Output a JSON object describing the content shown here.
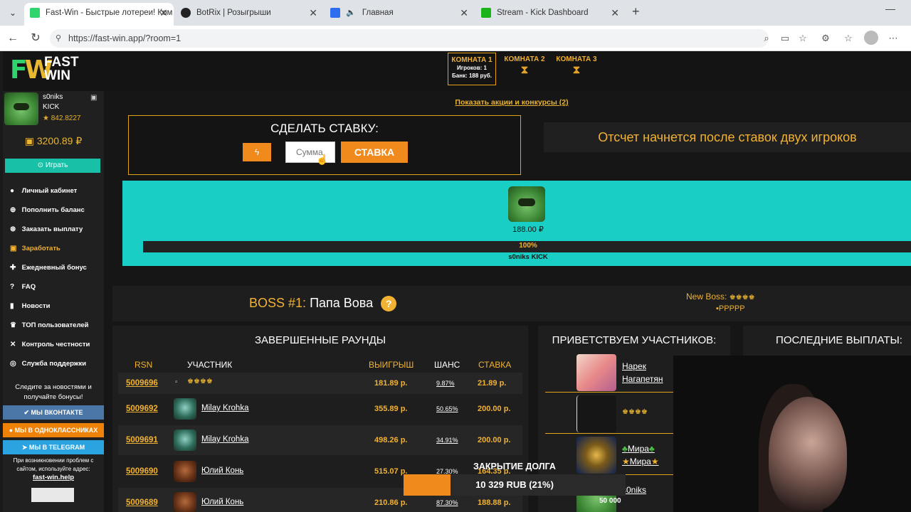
{
  "browser": {
    "tabs": [
      {
        "label": "Fast-Win - Быстрые лотереи! Ком",
        "active": true,
        "color": "#2fd46d"
      },
      {
        "label": "BotRix | Розыгрыши",
        "active": false,
        "color": "#222"
      },
      {
        "label": "Главная",
        "active": false,
        "color": "#2f6df0"
      },
      {
        "label": "Stream - Kick Dashboard",
        "active": false,
        "color": "#1bb51b"
      }
    ],
    "url": "https://fast-win.app/?room=1"
  },
  "site": {
    "logo_line1": "FAST",
    "logo_line2": "WIN",
    "rooms": [
      {
        "name": "КОМНАТА 1",
        "info1": "Игроков: 1",
        "info2": "Банк: 188 руб.",
        "active": true
      },
      {
        "name": "КОМНАТА 2",
        "active": false
      },
      {
        "name": "КОМНАТА 3",
        "active": false
      }
    ]
  },
  "sidebar": {
    "user_name": "s0niks",
    "user_sub": "KICK",
    "rating": "★ 842.8227",
    "balance": "3200.89 ₽",
    "play_label": "Играть",
    "menu": [
      {
        "label": "Личный кабинет",
        "icon": "person-icon"
      },
      {
        "label": "Пополнить баланс",
        "icon": "plus-circle-icon"
      },
      {
        "label": "Заказать выплату",
        "icon": "download-circle-icon"
      },
      {
        "label": "Заработать",
        "icon": "money-icon",
        "gold": true
      },
      {
        "label": "Ежедневный бонус",
        "icon": "gift-icon"
      },
      {
        "label": "FAQ",
        "icon": "question-icon"
      },
      {
        "label": "Новости",
        "icon": "bookmark-icon"
      },
      {
        "label": "ТОП пользователей",
        "icon": "trophy-icon"
      },
      {
        "label": "Контроль честности",
        "icon": "shuffle-icon"
      },
      {
        "label": "Служба поддержки",
        "icon": "support-icon"
      }
    ],
    "follow_text_1": "Следите за новостями и",
    "follow_text_2": "получайте бонусы!",
    "vk_label": "МЫ ВКОНТАКТЕ",
    "ok_label": "МЫ В ОДНОКЛАССНИКАХ",
    "tg_label": "МЫ В TELEGRAM",
    "help_text_1": "При возникновении проблем с",
    "help_text_2": "сайтом, используйте адрес:",
    "help_link": "fast-win.help"
  },
  "main": {
    "promo_link": "Показать акции и конкурсы (2)",
    "bet_title": "СДЕЛАТЬ СТАВКУ:",
    "bet_placeholder": "Сумма",
    "bet_button": "СТАВКА",
    "countdown_text": "Отсчет начнется после ставок двух игроков",
    "player_amount": "188.00 ₽",
    "progress_pct": "100%",
    "progress_value": 1.0,
    "progress_name": "s0niks KICK",
    "boss_num": "BOSS #1:",
    "boss_name": "Папа Вова",
    "new_boss_label": "New Boss:",
    "new_boss_name": "PPPPP"
  },
  "rounds": {
    "title": "ЗАВЕРШЕННЫЕ РАУНДЫ",
    "headers": {
      "rsn": "RSN",
      "player": "УЧАСТНИК",
      "win": "ВЫИГРЫШ",
      "chance": "ШАНС",
      "stake": "СТАВКА"
    },
    "rows": [
      {
        "id": "5009696",
        "name": "",
        "win": "181.89 р.",
        "chance": "9.87%",
        "stake": "21.89 р."
      },
      {
        "id": "5009692",
        "name": "Milay Krohka",
        "win": "355.89 р.",
        "chance": "50.65%",
        "stake": "200.00 р."
      },
      {
        "id": "5009691",
        "name": "Milay Krohka",
        "win": "498.26 р.",
        "chance": "34.91%",
        "stake": "200.00 р."
      },
      {
        "id": "5009690",
        "name": "Юлий Конь",
        "win": "515.07 р.",
        "chance": "27.30%",
        "stake": "164.35 р."
      },
      {
        "id": "5009689",
        "name": "Юлий Конь",
        "win": "210.86 р.",
        "chance": "87.30%",
        "stake": "188.88 р."
      }
    ]
  },
  "welcome": {
    "title": "ПРИВЕТСТВУЕМ УЧАСТНИКОВ:",
    "users": [
      {
        "name_1": "Нарек",
        "name_2": "Нагапетян"
      },
      {
        "name_1": "",
        "name_2": ""
      },
      {
        "name_1": "Мира",
        "name_2": "Мира"
      },
      {
        "name_1": "s0niks",
        "name_2": ""
      }
    ]
  },
  "payouts": {
    "title": "ПОСЛЕДНИЕ ВЫПЛАТЫ:"
  },
  "overlay": {
    "goal_title": "ЗАКРЫТИЕ ДОЛГА",
    "goal_text": "10 329 RUB (21%)",
    "goal_fraction": 0.21,
    "goal_tag": "50 000"
  }
}
